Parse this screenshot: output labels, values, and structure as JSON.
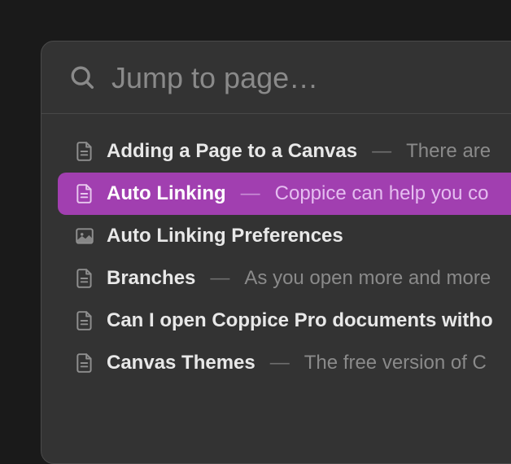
{
  "search": {
    "placeholder": "Jump to page…",
    "value": ""
  },
  "separator": "—",
  "colors": {
    "accent": "#a13fb0"
  },
  "results": [
    {
      "icon": "document",
      "title": "Adding a Page to a Canvas",
      "snippet": "There are",
      "selected": false
    },
    {
      "icon": "document",
      "title": "Auto Linking",
      "snippet": "Coppice can help you co",
      "selected": true
    },
    {
      "icon": "image",
      "title": "Auto Linking Preferences",
      "snippet": "",
      "selected": false
    },
    {
      "icon": "document",
      "title": "Branches",
      "snippet": "As you open more and more",
      "selected": false
    },
    {
      "icon": "document",
      "title": "Can I open Coppice Pro documents witho",
      "snippet": "",
      "selected": false
    },
    {
      "icon": "document",
      "title": "Canvas Themes",
      "snippet": "The free version of C",
      "selected": false
    }
  ]
}
